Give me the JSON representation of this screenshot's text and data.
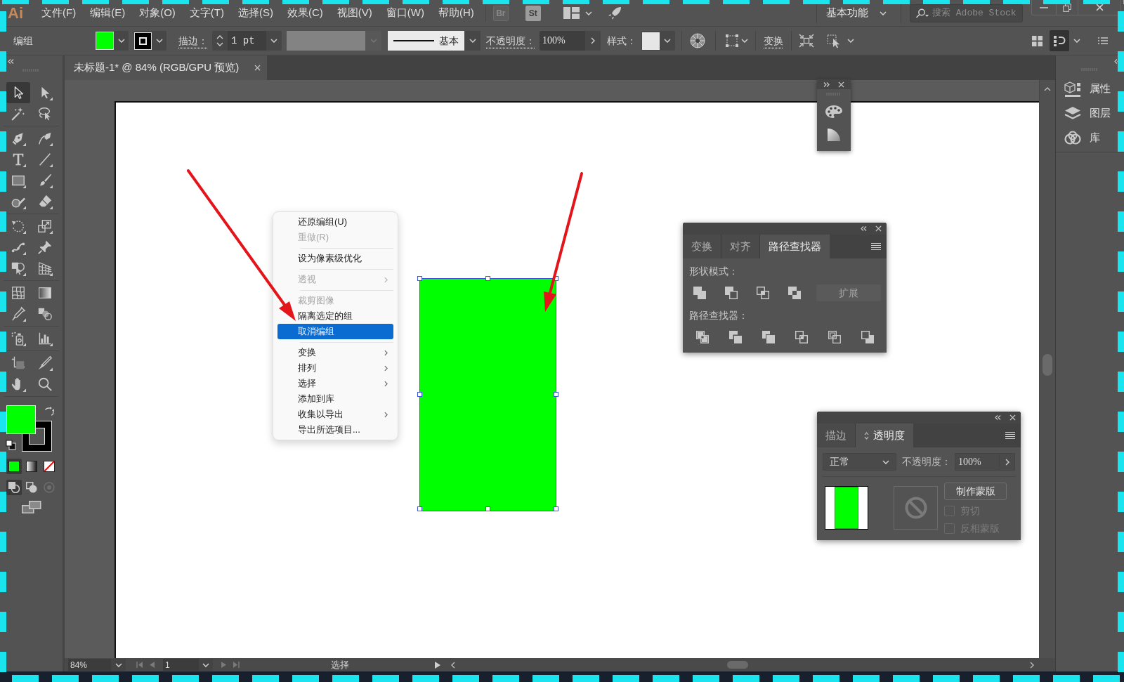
{
  "menu_bar": {
    "logo": "Ai",
    "items": [
      "文件(F)",
      "编辑(E)",
      "对象(O)",
      "文字(T)",
      "选择(S)",
      "效果(C)",
      "视图(V)",
      "窗口(W)",
      "帮助(H)"
    ],
    "bridge": "Br",
    "stock": "St",
    "workspace": "基本功能",
    "search": {
      "placeholder": "搜索 Adobe Stock"
    }
  },
  "control_bar": {
    "selection": "编组",
    "stroke_label": "描边：",
    "stroke_weight": "1 pt",
    "stroke_profile": "基本",
    "opacity_label": "不透明度：",
    "opacity": "100%",
    "style_label": "样式：",
    "transform_label": "变换",
    "view_toggles": [
      {
        "kind": "grid",
        "selected": false
      },
      {
        "kind": "properties",
        "selected": true
      }
    ]
  },
  "toolbar": {
    "tool_groups": [
      {
        "tools": [
          {
            "kind": "selection",
            "selected": true
          },
          {
            "kind": "direct",
            "selected": false
          },
          {
            "kind": "wand",
            "selected": false
          },
          {
            "kind": "lasso",
            "selected": false
          }
        ]
      },
      {
        "tools": [
          {
            "kind": "pen",
            "selected": false
          },
          {
            "kind": "curvature",
            "selected": false
          },
          {
            "kind": "type",
            "selected": false
          },
          {
            "kind": "line",
            "selected": false
          },
          {
            "kind": "rectangle",
            "selected": false
          },
          {
            "kind": "brush",
            "selected": false
          },
          {
            "kind": "shaper",
            "selected": false
          },
          {
            "kind": "eraser",
            "selected": false
          }
        ]
      },
      {
        "tools": [
          {
            "kind": "rotate",
            "selected": false
          },
          {
            "kind": "scale",
            "selected": false
          },
          {
            "kind": "puppet",
            "selected": false
          },
          {
            "kind": "pin",
            "selected": false
          },
          {
            "kind": "builder",
            "selected": false
          },
          {
            "kind": "perspective",
            "selected": false
          }
        ]
      },
      {
        "tools": [
          {
            "kind": "mesh",
            "selected": false
          },
          {
            "kind": "gradient",
            "selected": false
          },
          {
            "kind": "eyedropper",
            "selected": false
          },
          {
            "kind": "blend",
            "selected": false
          }
        ]
      },
      {
        "tools": [
          {
            "kind": "sprayer",
            "selected": false
          },
          {
            "kind": "graph",
            "selected": false
          }
        ]
      },
      {
        "tools": [
          {
            "kind": "artboard",
            "selected": false
          },
          {
            "kind": "knife",
            "selected": false
          },
          {
            "kind": "hand",
            "selected": false
          },
          {
            "kind": "zoom",
            "selected": false
          }
        ]
      }
    ],
    "color_modes": [
      {
        "kind": "color",
        "selected": true
      },
      {
        "kind": "gradient",
        "selected": false
      },
      {
        "kind": "none",
        "selected": false
      }
    ],
    "draw_modes": [
      {
        "kind": "normal",
        "selected": true,
        "disabled": false
      },
      {
        "kind": "behind",
        "selected": false,
        "disabled": false
      },
      {
        "kind": "inside",
        "selected": false,
        "disabled": true
      }
    ]
  },
  "document_tab": {
    "title": "未标题-1* @ 84% (RGB/GPU 预览)"
  },
  "context_menu": {
    "items": [
      {
        "kind": "item",
        "label": "还原编组(U)",
        "disabled": false,
        "selected": false,
        "has_submenu": false
      },
      {
        "kind": "item",
        "label": "重做(R)",
        "disabled": true,
        "selected": false,
        "has_submenu": false
      },
      {
        "kind": "separator"
      },
      {
        "kind": "item",
        "label": "设为像素级优化",
        "disabled": false,
        "selected": false,
        "has_submenu": false
      },
      {
        "kind": "separator"
      },
      {
        "kind": "item",
        "label": "透视",
        "disabled": true,
        "selected": false,
        "has_submenu": true
      },
      {
        "kind": "separator"
      },
      {
        "kind": "item",
        "label": "裁剪图像",
        "disabled": true,
        "selected": false,
        "has_submenu": false
      },
      {
        "kind": "item",
        "label": "隔离选定的组",
        "disabled": false,
        "selected": false,
        "has_submenu": false
      },
      {
        "kind": "item",
        "label": "取消编组",
        "disabled": false,
        "selected": true,
        "has_submenu": false
      },
      {
        "kind": "separator"
      },
      {
        "kind": "item",
        "label": "变换",
        "disabled": false,
        "selected": false,
        "has_submenu": true
      },
      {
        "kind": "item",
        "label": "排列",
        "disabled": false,
        "selected": false,
        "has_submenu": true
      },
      {
        "kind": "item",
        "label": "选择",
        "disabled": false,
        "selected": false,
        "has_submenu": true
      },
      {
        "kind": "item",
        "label": "添加到库",
        "disabled": false,
        "selected": false,
        "has_submenu": false
      },
      {
        "kind": "item",
        "label": "收集以导出",
        "disabled": false,
        "selected": false,
        "has_submenu": true
      },
      {
        "kind": "item",
        "label": "导出所选项目...",
        "disabled": false,
        "selected": false,
        "has_submenu": false
      }
    ]
  },
  "pathfinder_panel": {
    "tabs": [
      {
        "label": "变换",
        "selected": false
      },
      {
        "label": "对齐",
        "selected": false
      },
      {
        "label": "路径查找器",
        "selected": true
      }
    ],
    "shape_modes_label": "形状模式：",
    "expand_button": {
      "label": "扩展",
      "disabled": true
    },
    "pathfinders_label": "路径查找器："
  },
  "transparency_panel": {
    "tabs": [
      {
        "label": "描边",
        "selected": false
      },
      {
        "label": "透明度",
        "selected": true
      }
    ],
    "blend_mode": "正常",
    "opacity_label": "不透明度：",
    "opacity": "100%",
    "make_mask_button": "制作蒙版",
    "options": [
      {
        "label": "剪切",
        "checked": false,
        "disabled": true
      },
      {
        "label": "反相蒙版",
        "checked": false,
        "disabled": true
      }
    ]
  },
  "right_dock": {
    "items": [
      {
        "kind": "properties",
        "label": "属性"
      },
      {
        "kind": "layers",
        "label": "图层"
      },
      {
        "kind": "libraries",
        "label": "库"
      }
    ]
  },
  "status_bar": {
    "zoom": "84%",
    "artboard": "1",
    "tool": "选择"
  }
}
